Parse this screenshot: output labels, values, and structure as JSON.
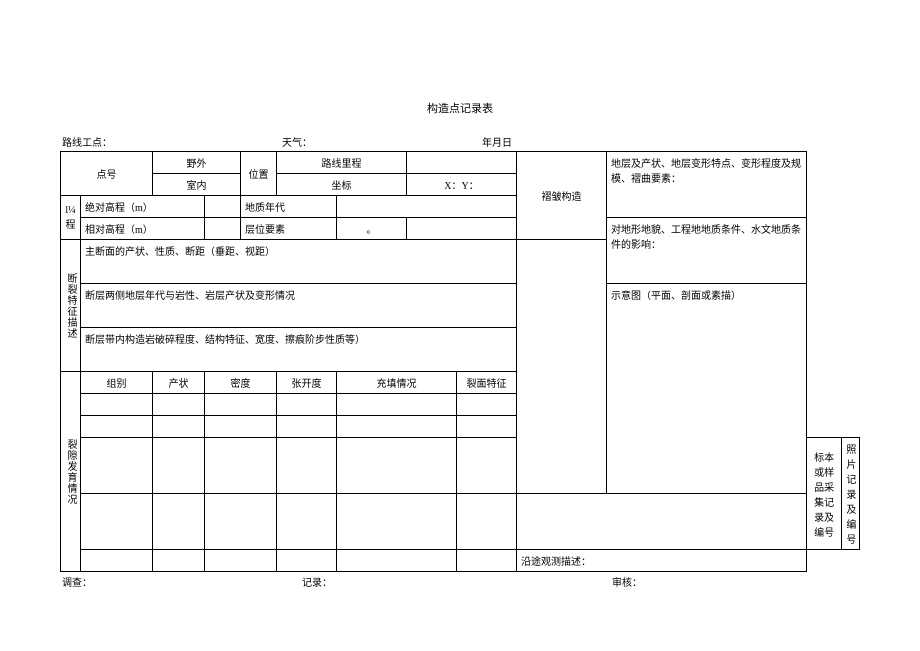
{
  "title": "构造点记录表",
  "top": {
    "route_label": "路线工点：",
    "route_value": "",
    "weather_label": "天气：",
    "weather_value": "",
    "date_label": "年月日",
    "date_value": ""
  },
  "labels": {
    "point_no": "点号",
    "field": "野外",
    "indoor": "室内",
    "position": "位置",
    "route_mileage": "路线里程",
    "coord": "坐标",
    "coord_value": "X：Y：",
    "fold_structure": "褶皱构造",
    "fold_text1": "地层及产状、地层变形特点、变形程度及规模、褶曲要素：",
    "elevation_header": "l¼程",
    "abs_elev": "绝对高程（m）",
    "rel_elev": "相对高程（m）",
    "geo_age": "地质年代",
    "layer_elements": "层位要素",
    "layer_symbol": "。",
    "impact_text": "对地形地貌、工程地地质条件、水文地质条件的影响：",
    "fault_desc_v": "断裂特征描述",
    "fault_row1": "主断面的产状、性质、断距（垂距、视距）",
    "fault_row2": "断层两侧地层年代与岩性、岩层产状及变形情况",
    "fault_row3": "断层带内构造岩破碎程度、结构特征、宽度、擦痕阶步性质等）",
    "sketch_label": "示意图（平面、剖面或素描）",
    "joint_v": "裂隙发育情况",
    "joint_group": "组别",
    "joint_attitude": "产状",
    "joint_density": "密度",
    "joint_open": "张开度",
    "joint_fill": "充填情况",
    "joint_face": "裂面特征",
    "sample_note": "标本或样品采集记录及编号",
    "photo_note": "照片记录及编号",
    "route_obs": "沿途观测描述："
  },
  "bottom": {
    "survey_label": "调查：",
    "record_label": "记录：",
    "review_label": "审核："
  }
}
